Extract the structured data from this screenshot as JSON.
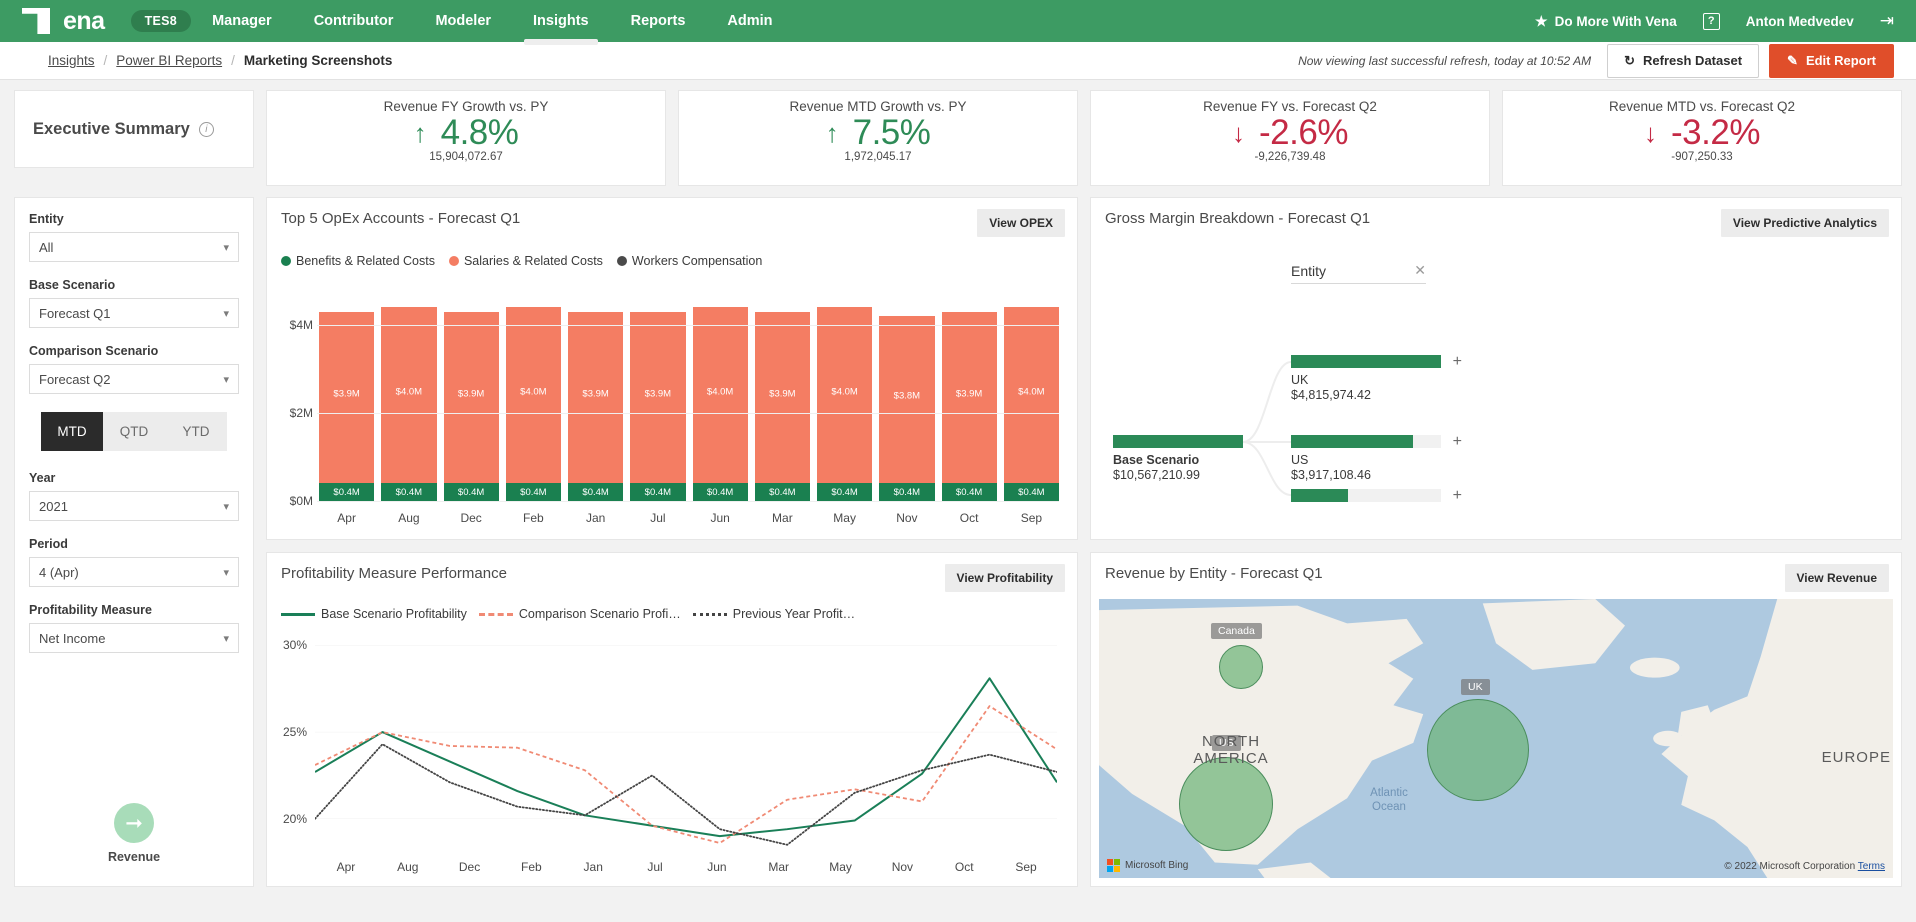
{
  "topnav": {
    "brand": "ena",
    "env_badge": "TES8",
    "items": [
      {
        "label": "Manager",
        "active": false
      },
      {
        "label": "Contributor",
        "active": false
      },
      {
        "label": "Modeler",
        "active": false
      },
      {
        "label": "Insights",
        "active": true
      },
      {
        "label": "Reports",
        "active": false
      },
      {
        "label": "Admin",
        "active": false
      }
    ],
    "do_more": "Do More With Vena",
    "help": "?",
    "user": "Anton Medvedev"
  },
  "breadcrumb": {
    "items": [
      "Insights",
      "Power BI Reports"
    ],
    "current": "Marketing Screenshots",
    "refresh_note": "Now viewing last successful refresh, today at 10:52 AM",
    "refresh_button": "Refresh Dataset",
    "edit_button": "Edit Report"
  },
  "exec": {
    "title": "Executive Summary"
  },
  "kpis": [
    {
      "title": "Revenue FY Growth vs. PY",
      "arrow": "↑",
      "value": "4.8%",
      "sub": "15,904,072.67",
      "tone": "pos"
    },
    {
      "title": "Revenue MTD Growth vs. PY",
      "arrow": "↑",
      "value": "7.5%",
      "sub": "1,972,045.17",
      "tone": "pos"
    },
    {
      "title": "Revenue FY vs. Forecast Q2",
      "arrow": "↓",
      "value": "-2.6%",
      "sub": "-9,226,739.48",
      "tone": "neg"
    },
    {
      "title": "Revenue MTD vs. Forecast Q2",
      "arrow": "↓",
      "value": "-3.2%",
      "sub": "-907,250.33",
      "tone": "neg"
    }
  ],
  "filters": {
    "entity_label": "Entity",
    "entity_value": "All",
    "base_scenario_label": "Base Scenario",
    "base_scenario_value": "Forecast Q1",
    "comparison_label": "Comparison Scenario",
    "comparison_value": "Forecast Q2",
    "segments": [
      {
        "label": "MTD",
        "active": true
      },
      {
        "label": "QTD",
        "active": false
      },
      {
        "label": "YTD",
        "active": false
      }
    ],
    "year_label": "Year",
    "year_value": "2021",
    "period_label": "Period",
    "period_value": "4 (Apr)",
    "profitability_label": "Profitability Measure",
    "profitability_value": "Net Income",
    "revenue_caption": "Revenue"
  },
  "opex": {
    "title": "Top 5 OpEx Accounts -  Forecast Q1",
    "button": "View OPEX"
  },
  "gross_margin": {
    "title": "Gross Margin Breakdown -  Forecast Q1",
    "button": "View Predictive Analytics",
    "node_header": "Entity",
    "root": {
      "name": "Base Scenario",
      "value": "$10,567,210.99"
    },
    "children": [
      {
        "name": "UK",
        "value": "$4,815,974.42"
      },
      {
        "name": "US",
        "value": "$3,917,108.46"
      },
      {
        "name": "",
        "value": ""
      }
    ]
  },
  "profitability": {
    "title": "Profitability Measure Performance",
    "button": "View Profitability"
  },
  "revenue_map": {
    "title": "Revenue by Entity -  Forecast Q1",
    "button": "View Revenue",
    "continents": [
      "NORTH AMERICA",
      "EUROPE"
    ],
    "ocean": "Atlantic Ocean",
    "bubbles": [
      {
        "label": "Canada"
      },
      {
        "label": "US"
      },
      {
        "label": "UK"
      }
    ],
    "bing_attr": "Microsoft Bing",
    "credit": "© 2022 Microsoft Corporation",
    "terms": "Terms"
  },
  "colors": {
    "brand_green": "#3d9b63",
    "positive": "#2e8b57",
    "negative": "#c42a45",
    "edit_orange": "#e04e2a",
    "bar_salary": "#f47d63",
    "bar_benefits": "#1a8050",
    "bar_workers": "#4a4a4a",
    "tree_green": "#2b8a57"
  },
  "chart_data": [
    {
      "type": "bar",
      "id": "top5-opex",
      "title": "Top 5 OpEx Accounts -  Forecast Q1",
      "stacked": true,
      "categories": [
        "Apr",
        "Aug",
        "Dec",
        "Feb",
        "Jan",
        "Jul",
        "Jun",
        "Mar",
        "May",
        "Nov",
        "Oct",
        "Sep"
      ],
      "series": [
        {
          "name": "Benefits & Related Costs",
          "color": "#1a8050",
          "values": [
            0.4,
            0.4,
            0.4,
            0.4,
            0.4,
            0.4,
            0.4,
            0.4,
            0.4,
            0.4,
            0.4,
            0.4
          ],
          "labels": [
            "$0.4M",
            "$0.4M",
            "$0.4M",
            "$0.4M",
            "$0.4M",
            "$0.4M",
            "$0.4M",
            "$0.4M",
            "$0.4M",
            "$0.4M",
            "$0.4M",
            "$0.4M"
          ]
        },
        {
          "name": "Salaries & Related Costs",
          "color": "#f47d63",
          "values": [
            3.9,
            4.0,
            3.9,
            4.0,
            3.9,
            3.9,
            4.0,
            3.9,
            4.0,
            3.8,
            3.9,
            4.0
          ],
          "labels": [
            "$3.9M",
            "$4.0M",
            "$3.9M",
            "$4.0M",
            "$3.9M",
            "$3.9M",
            "$4.0M",
            "$3.9M",
            "$4.0M",
            "$3.8M",
            "$3.9M",
            "$4.0M"
          ]
        },
        {
          "name": "Workers Compensation",
          "color": "#4a4a4a",
          "values": [
            0,
            0,
            0,
            0,
            0,
            0,
            0,
            0,
            0,
            0,
            0,
            0
          ],
          "labels": []
        }
      ],
      "ylabel": "",
      "xlabel": "",
      "ytick_labels": [
        "$0M",
        "$2M",
        "$4M"
      ],
      "ytick_values": [
        0,
        2,
        4
      ],
      "ylim": [
        0,
        4.8
      ],
      "grid": true,
      "legend_position": "top"
    },
    {
      "type": "line",
      "id": "profitability-performance",
      "title": "Profitability Measure Performance",
      "categories": [
        "Apr",
        "Aug",
        "Dec",
        "Feb",
        "Jan",
        "Jul",
        "Jun",
        "Mar",
        "May",
        "Nov",
        "Oct",
        "Sep"
      ],
      "series": [
        {
          "name": "Base Scenario Profitability",
          "style": "solid",
          "color": "#1a7f58",
          "values": [
            22.7,
            25.0,
            23.3,
            21.6,
            20.2,
            19.6,
            19.0,
            19.4,
            19.9,
            22.6,
            28.1,
            22.1
          ]
        },
        {
          "name": "Comparison Scenario Profi…",
          "style": "dashed",
          "color": "#f08a74",
          "values": [
            23.1,
            25.0,
            24.2,
            24.1,
            22.8,
            19.6,
            18.6,
            21.1,
            21.7,
            21.0,
            26.5,
            24.0
          ]
        },
        {
          "name": "Previous Year Profit…",
          "style": "dotted",
          "color": "#444444",
          "values": [
            20.0,
            24.3,
            22.1,
            20.7,
            20.2,
            22.5,
            19.4,
            18.5,
            21.5,
            22.8,
            23.7,
            22.7
          ]
        }
      ],
      "ytick_labels": [
        "20%",
        "25%",
        "30%"
      ],
      "ytick_values": [
        20,
        25,
        30
      ],
      "ylim": [
        18.2,
        30.6
      ],
      "grid": true,
      "legend_position": "top"
    },
    {
      "type": "bar",
      "id": "gross-margin-decomposition",
      "title": "Gross Margin Breakdown -  Forecast Q1",
      "orientation": "horizontal",
      "categories": [
        "Base Scenario",
        "UK",
        "US",
        ""
      ],
      "values": [
        10567210.99,
        4815974.42,
        3917108.46,
        1834128.11
      ],
      "value_labels": [
        "$10,567,210.99",
        "$4,815,974.42",
        "$3,917,108.46",
        ""
      ],
      "grid": false
    },
    {
      "type": "scatter",
      "id": "revenue-by-entity-map",
      "title": "Revenue by Entity -  Forecast Q1",
      "categories": [
        "Canada",
        "US",
        "UK"
      ],
      "values": [
        1,
        5.1,
        5.6
      ],
      "xlabel": "longitude",
      "ylabel": "latitude",
      "grid": false
    }
  ]
}
